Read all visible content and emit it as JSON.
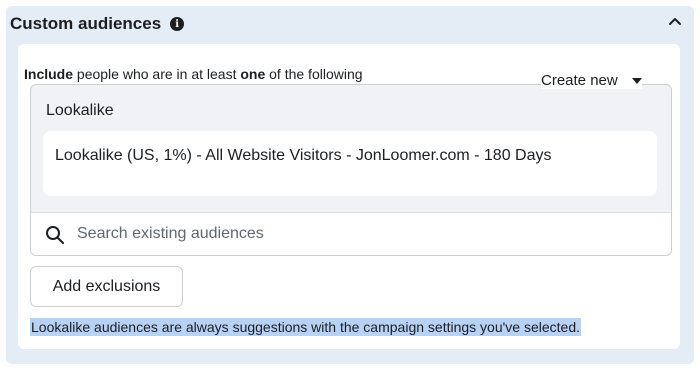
{
  "panel": {
    "title": "Custom audiences",
    "info_icon": "info-icon",
    "collapse_icon": "chevron-up-icon"
  },
  "include": {
    "prefix_bold": "Include",
    "middle": " people who are in at least ",
    "emphasis_bold": "one",
    "suffix": " of the following"
  },
  "create_new": {
    "label": "Create new",
    "icon": "caret-down-icon"
  },
  "audiences": {
    "group_label": "Lookalike",
    "selected_item": "Lookalike (US, 1%) - All Website Visitors - JonLoomer.com - 180 Days"
  },
  "search": {
    "placeholder": "Search existing audiences",
    "value": "",
    "icon": "search-icon"
  },
  "exclusions": {
    "button_label": "Add exclusions"
  },
  "note": {
    "text": "Lookalike audiences are always suggestions with the campaign settings you've selected."
  },
  "colors": {
    "panel_bg": "#e4ecf6",
    "text": "#1c1e21",
    "highlight": "#b7d2f5",
    "border": "#ccd0d5"
  }
}
